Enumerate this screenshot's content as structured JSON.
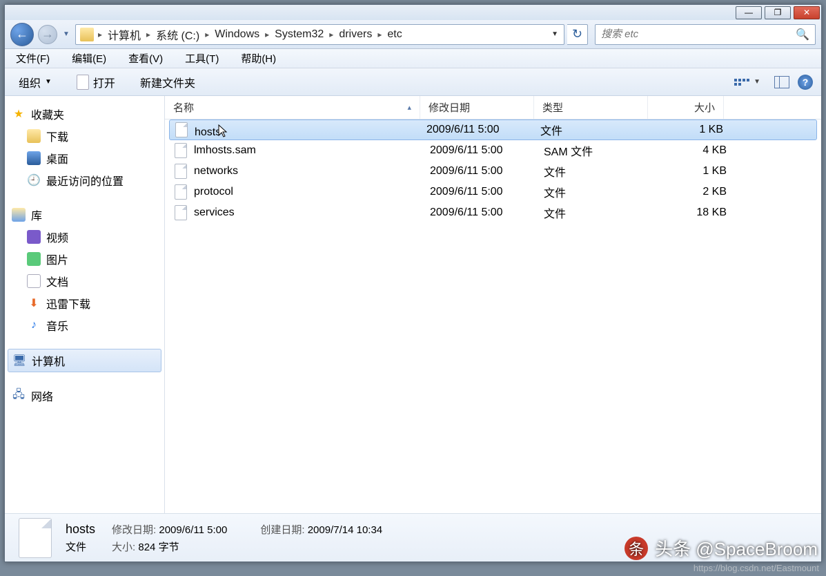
{
  "window_controls": {
    "min": "—",
    "max": "❐",
    "close": "✕"
  },
  "breadcrumb": [
    "计算机",
    "系统 (C:)",
    "Windows",
    "System32",
    "drivers",
    "etc"
  ],
  "search": {
    "placeholder": "搜索 etc"
  },
  "menu": {
    "file": "文件(F)",
    "edit": "编辑(E)",
    "view": "查看(V)",
    "tools": "工具(T)",
    "help": "帮助(H)"
  },
  "toolbar": {
    "organize": "组织",
    "open": "打开",
    "new_folder": "新建文件夹"
  },
  "sidebar": {
    "favorites": {
      "label": "收藏夹",
      "items": [
        "下载",
        "桌面",
        "最近访问的位置"
      ]
    },
    "libraries": {
      "label": "库",
      "items": [
        "视频",
        "图片",
        "文档",
        "迅雷下载",
        "音乐"
      ]
    },
    "computer": "计算机",
    "network": "网络"
  },
  "columns": {
    "name": "名称",
    "date": "修改日期",
    "type": "类型",
    "size": "大小"
  },
  "files": [
    {
      "name": "hosts",
      "date": "2009/6/11 5:00",
      "type": "文件",
      "size": "1 KB",
      "selected": true
    },
    {
      "name": "lmhosts.sam",
      "date": "2009/6/11 5:00",
      "type": "SAM 文件",
      "size": "4 KB",
      "selected": false
    },
    {
      "name": "networks",
      "date": "2009/6/11 5:00",
      "type": "文件",
      "size": "1 KB",
      "selected": false
    },
    {
      "name": "protocol",
      "date": "2009/6/11 5:00",
      "type": "文件",
      "size": "2 KB",
      "selected": false
    },
    {
      "name": "services",
      "date": "2009/6/11 5:00",
      "type": "文件",
      "size": "18 KB",
      "selected": false
    }
  ],
  "details": {
    "name": "hosts",
    "type": "文件",
    "mod_label": "修改日期:",
    "mod_value": "2009/6/11 5:00",
    "size_label": "大小:",
    "size_value": "824 字节",
    "created_label": "创建日期:",
    "created_value": "2009/7/14 10:34"
  },
  "watermark": {
    "text": "头条 @SpaceBroom",
    "url": "https://blog.csdn.net/Eastmount"
  }
}
